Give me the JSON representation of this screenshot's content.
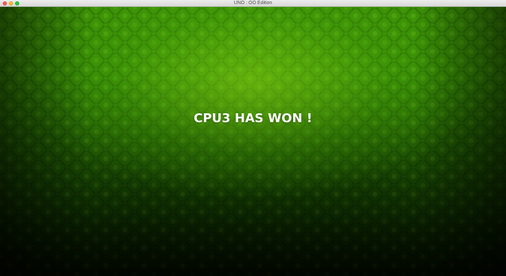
{
  "window": {
    "title": "UNO : OO Edition"
  },
  "game": {
    "message": "CPU3 HAS WON !"
  },
  "icons": {
    "close": "close-button",
    "minimize": "minimize-button",
    "maximize": "zoom-button"
  },
  "colors": {
    "background_green": "#3e9a06",
    "background_dark": "#0b2a00",
    "message_text": "#ffffff"
  }
}
